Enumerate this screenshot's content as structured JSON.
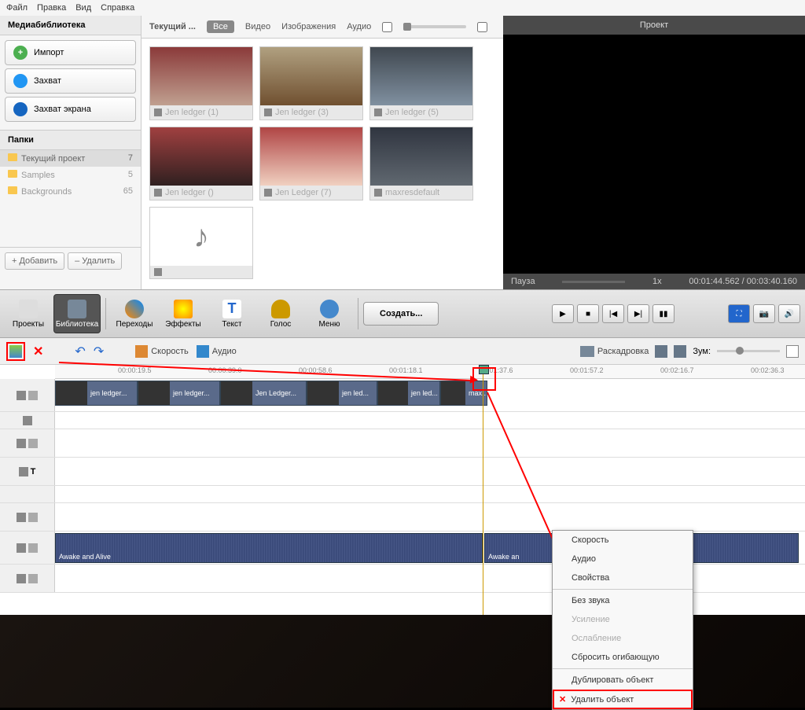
{
  "menubar": {
    "file": "Файл",
    "edit": "Правка",
    "view": "Вид",
    "help": "Справка"
  },
  "library_panel": {
    "title": "Медиабиблиотека",
    "import": "Импорт",
    "capture": "Захват",
    "screen_capture": "Захват экрана",
    "folders_title": "Папки",
    "folders": [
      {
        "name": "Текущий проект",
        "count": "7"
      },
      {
        "name": "Samples",
        "count": "5"
      },
      {
        "name": "Backgrounds",
        "count": "65"
      }
    ],
    "add": "+ Добавить",
    "delete": "– Удалить"
  },
  "lib_tabs": {
    "current": "Текущий ...",
    "all": "Все",
    "video": "Видео",
    "images": "Изображения",
    "audio": "Аудио"
  },
  "clips": [
    {
      "label": "Jen ledger (1)"
    },
    {
      "label": "Jen ledger (3)"
    },
    {
      "label": "Jen ledger (5)"
    },
    {
      "label": "Jen ledger ()"
    },
    {
      "label": "Jen Ledger (7)"
    },
    {
      "label": "maxresdefault"
    }
  ],
  "preview": {
    "title": "Проект",
    "status": "Пауза",
    "speed": "1x",
    "time": "00:01:44.562 / 00:03:40.160"
  },
  "toolbar": {
    "projects": "Проекты",
    "library": "Библиотека",
    "transitions": "Переходы",
    "effects": "Эффекты",
    "text": "Текст",
    "voice": "Голос",
    "menu": "Меню",
    "create": "Создать..."
  },
  "timeline_toolbar": {
    "speed": "Скорость",
    "audio": "Аудио",
    "storyboard": "Раскадровка",
    "zoom": "Зум:"
  },
  "ruler": [
    "00:00:19.5",
    "00:00:39.0",
    "00:00:58.6",
    "00:01:18.1",
    "00:01:37.6",
    "00:01:57.2",
    "00:02:16.7",
    "00:02:36.3"
  ],
  "video_clips": [
    {
      "label": "jen ledger..."
    },
    {
      "label": "jen ledger..."
    },
    {
      "label": "Jen Ledger..."
    },
    {
      "label": "jen led..."
    },
    {
      "label": "jen led..."
    },
    {
      "label": "max..."
    }
  ],
  "audio_clip": {
    "label1": "Awake and Alive",
    "label2": "Awake an"
  },
  "context_menu": {
    "speed": "Скорость",
    "audio": "Аудио",
    "properties": "Свойства",
    "mute": "Без звука",
    "amplify": "Усиление",
    "fade": "Ослабление",
    "reset_envelope": "Сбросить огибающую",
    "duplicate": "Дублировать объект",
    "delete": "Удалить объект"
  }
}
